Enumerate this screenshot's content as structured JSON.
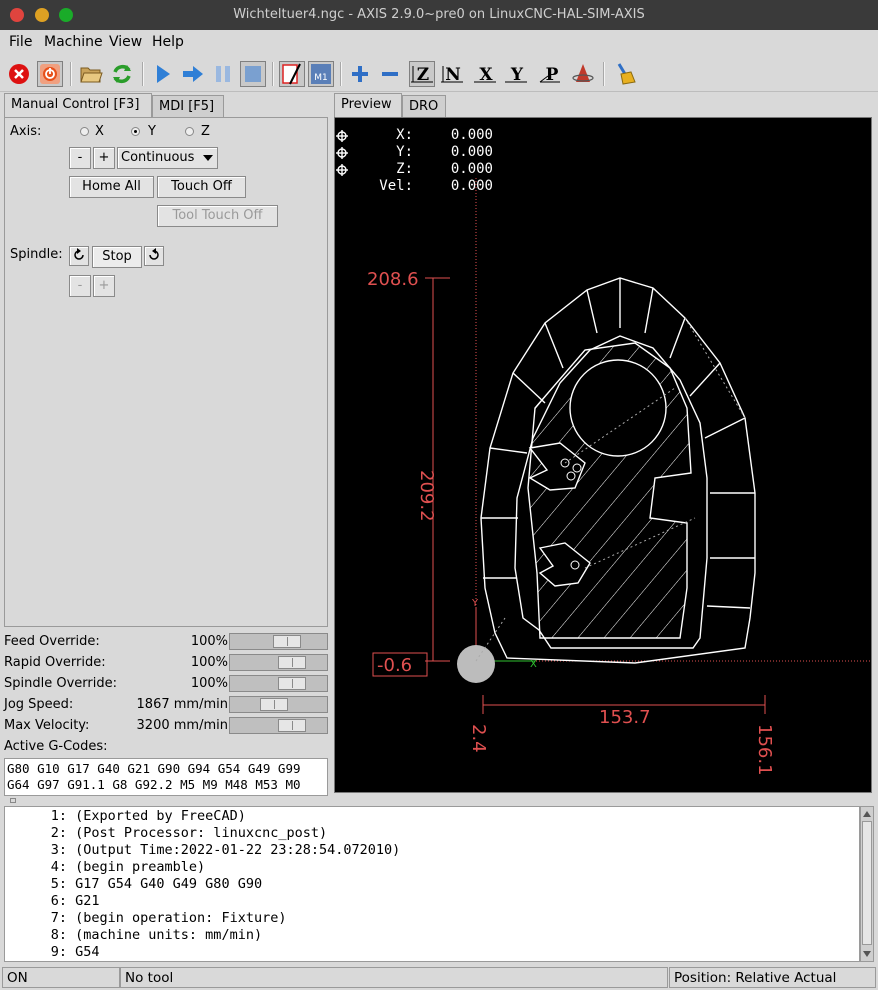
{
  "window": {
    "title": "Wichteltuer4.ngc - AXIS 2.9.0~pre0 on LinuxCNC-HAL-SIM-AXIS"
  },
  "menu": [
    "File",
    "Machine",
    "View",
    "Help"
  ],
  "toolbar": {
    "icons": [
      "estop-icon",
      "machine-power-icon",
      "open-file-icon",
      "reload-icon",
      "run-icon",
      "step-icon",
      "pause-icon",
      "stop-program-icon",
      "block-delete-icon",
      "optional-stop-icon",
      "zoom-in-icon",
      "zoom-out-icon",
      "view-z-icon",
      "view-rotated-z-icon",
      "view-x-icon",
      "view-y-icon",
      "view-perspective-icon",
      "toggle-rotation-icon",
      "clear-plot-icon"
    ]
  },
  "left_tabs": [
    {
      "label": "Manual Control [F3]",
      "active": true
    },
    {
      "label": "MDI [F5]",
      "active": false
    }
  ],
  "manual": {
    "axis_label": "Axis:",
    "axes": [
      {
        "label": "X",
        "selected": false
      },
      {
        "label": "Y",
        "selected": true
      },
      {
        "label": "Z",
        "selected": false
      }
    ],
    "jog_minus": "-",
    "jog_plus": "+",
    "jog_mode": "Continuous",
    "home_all": "Home All",
    "touch_off": "Touch Off",
    "tool_touch_off": "Tool Touch Off",
    "spindle_label": "Spindle:",
    "spindle_stop": "Stop",
    "spindle_minus": "-",
    "spindle_plus": "+"
  },
  "overrides": [
    {
      "name": "Feed Override:",
      "value": "100",
      "unit": "%",
      "level": 0.64
    },
    {
      "name": "Rapid Override:",
      "value": "100",
      "unit": "%",
      "level": 0.72
    },
    {
      "name": "Spindle Override:",
      "value": "100",
      "unit": "%",
      "level": 0.72
    },
    {
      "name": "Jog Speed:",
      "value": "1867",
      "unit": "mm/min",
      "level": 0.45
    },
    {
      "name": "Max Velocity:",
      "value": "3200",
      "unit": "mm/min",
      "level": 0.72
    }
  ],
  "gcodes": {
    "label": "Active G-Codes:",
    "line1": "G80 G10 G17 G40 G21 G90 G94 G54 G49 G99",
    "line2": "G64 G97 G91.1 G8 G92.2 M5 M9 M48 M53 M0"
  },
  "right_tabs": [
    {
      "label": "Preview",
      "active": true
    },
    {
      "label": "DRO",
      "active": false
    }
  ],
  "dro": [
    {
      "axis": "X:",
      "value": "0.000"
    },
    {
      "axis": "Y:",
      "value": "0.000"
    },
    {
      "axis": "Z:",
      "value": "0.000"
    },
    {
      "axis": "Vel:",
      "value": "0.000"
    }
  ],
  "preview": {
    "dim_top": "208.6",
    "dim_height": "209.2",
    "dim_y_min": "-0.6",
    "dim_width": "153.7",
    "dim_x_min": "2.4",
    "dim_x_max": "156.1",
    "axis_y_label": "Y",
    "axis_x_label": "X"
  },
  "code": [
    {
      "n": "1:",
      "text": "(Exported by FreeCAD)"
    },
    {
      "n": "2:",
      "text": "(Post Processor: linuxcnc_post)"
    },
    {
      "n": "3:",
      "text": "(Output Time:2022-01-22 23:28:54.072010)"
    },
    {
      "n": "4:",
      "text": "(begin preamble)"
    },
    {
      "n": "5:",
      "text": "G17 G54 G40 G49 G80 G90"
    },
    {
      "n": "6:",
      "text": "G21"
    },
    {
      "n": "7:",
      "text": "(begin operation: Fixture)"
    },
    {
      "n": "8:",
      "text": "(machine units: mm/min)"
    },
    {
      "n": "9:",
      "text": "G54"
    }
  ],
  "status": {
    "state": "ON",
    "tool": "No tool",
    "position": "Position: Relative Actual"
  }
}
